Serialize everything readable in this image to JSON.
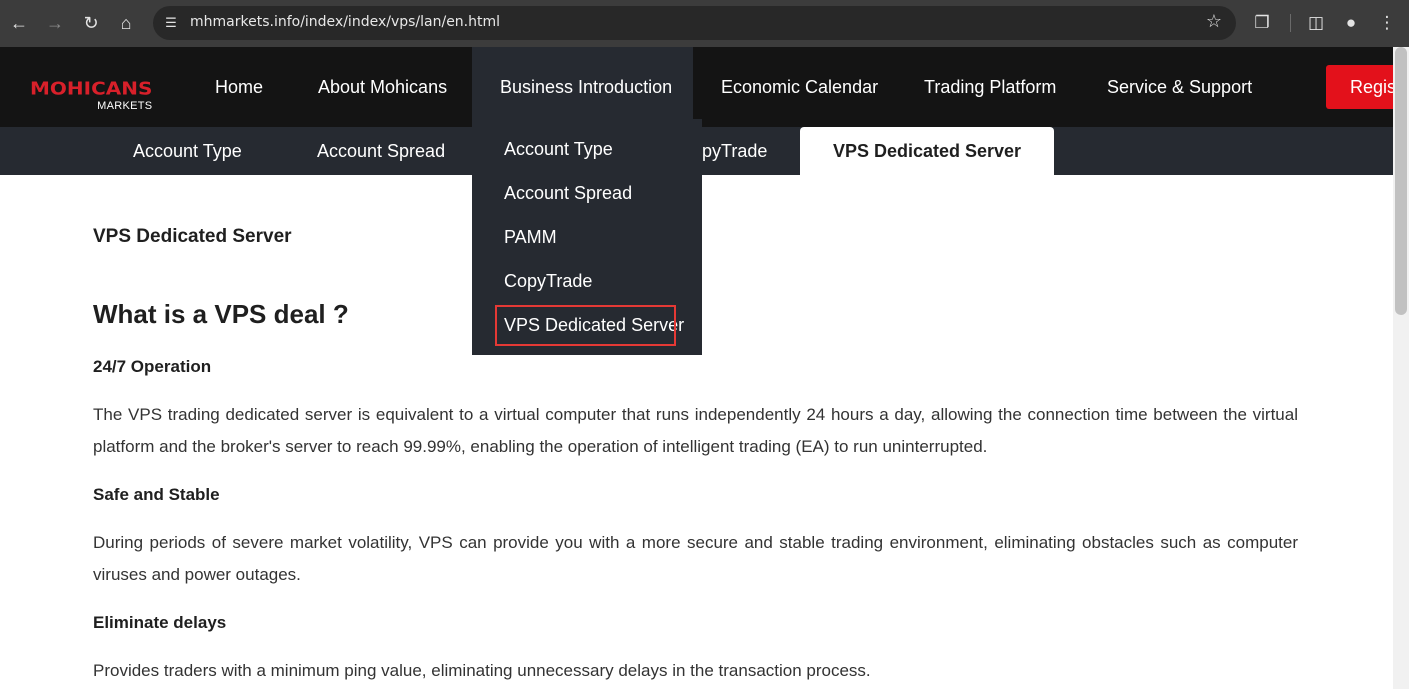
{
  "browser": {
    "url": "mhmarkets.info/index/index/vps/lan/en.html",
    "icons": [
      "back-icon",
      "forward-icon",
      "reload-icon",
      "home-icon",
      "site-settings-icon",
      "bookmark-star-icon",
      "extensions-icon",
      "side-panel-icon",
      "profile-icon",
      "menu-icon"
    ]
  },
  "header": {
    "logo_brand": "MOHICANS",
    "logo_sub": "MARKETS",
    "nav": {
      "home": "Home",
      "about": "About Mohicans",
      "business": "Business Introduction",
      "calendar": "Economic Calendar",
      "platform": "Trading Platform",
      "support": "Service & Support"
    },
    "register_label": "Regist"
  },
  "subnav": {
    "tabs": [
      "Account Type",
      "Account Spread",
      "PAMM",
      "CopyTrade",
      "VPS Dedicated Server"
    ],
    "visible_copytrade_fragment": "pyTrade",
    "active": "VPS Dedicated Server"
  },
  "dropdown": {
    "items": [
      "Account Type",
      "Account Spread",
      "PAMM",
      "CopyTrade",
      "VPS Dedicated Server"
    ],
    "highlighted": "VPS Dedicated Server"
  },
  "content": {
    "page_title": "VPS Dedicated Server",
    "heading": "What is a VPS deal ?",
    "sections": [
      {
        "title": "24/7 Operation",
        "text": "The VPS trading dedicated server is equivalent to a virtual computer that runs independently 24 hours a day, allowing the connection time between the virtual platform and the broker's server to reach 99.99%, enabling the operation of intelligent trading (EA) to run uninterrupted."
      },
      {
        "title": "Safe and Stable",
        "text": "During periods of severe market volatility, VPS can provide you with a more secure and stable trading environment, eliminating obstacles such as computer viruses and power outages."
      },
      {
        "title": "Eliminate delays",
        "text": "Provides traders with a minimum ping value, eliminating unnecessary delays in the transaction process."
      }
    ]
  },
  "colors": {
    "header_bg": "#141414",
    "subnav_bg": "#262a31",
    "brand_red": "#d8202a",
    "register_red": "#e3111b",
    "highlight_border": "#e53935"
  }
}
